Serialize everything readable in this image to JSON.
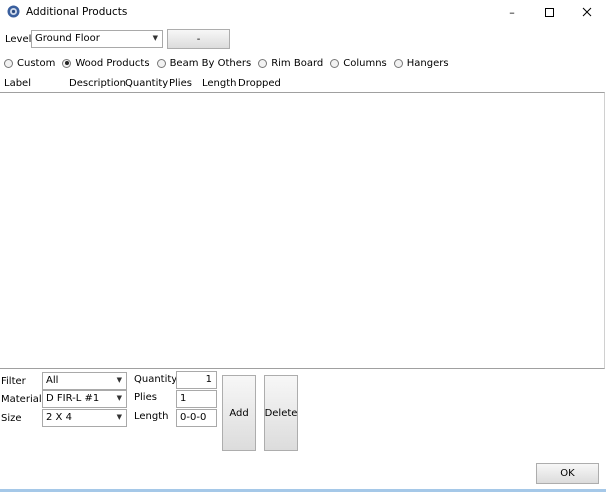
{
  "window": {
    "title": "Additional Products",
    "minimize_glyph": "–",
    "maximize_glyph": "☐",
    "close_glyph": "✕"
  },
  "level": {
    "label": "Level",
    "value": "Ground Floor",
    "button_label": "-"
  },
  "product_types": [
    {
      "label": "Custom",
      "selected": false
    },
    {
      "label": "Wood Products",
      "selected": true
    },
    {
      "label": "Beam By Others",
      "selected": false
    },
    {
      "label": "Rim Board",
      "selected": false
    },
    {
      "label": "Columns",
      "selected": false
    },
    {
      "label": "Hangers",
      "selected": false
    }
  ],
  "columns": [
    "Label",
    "Description",
    "Quantity",
    "Plies",
    "Length",
    "Dropped"
  ],
  "rows": [],
  "filter": {
    "label": "Filter",
    "value": "All"
  },
  "material": {
    "label": "Material",
    "value": "D FIR-L #1"
  },
  "size": {
    "label": "Size",
    "value": "2 X 4"
  },
  "quantity": {
    "label": "Quantity",
    "value": "1"
  },
  "plies": {
    "label": "Plies",
    "value": "1"
  },
  "length": {
    "label": "Length",
    "value": "0-0-0"
  },
  "buttons": {
    "add": "Add",
    "delete": "Delete",
    "ok": "OK"
  },
  "colors": {
    "accent": "#5b9bd5",
    "border": "#a9a9a9"
  }
}
